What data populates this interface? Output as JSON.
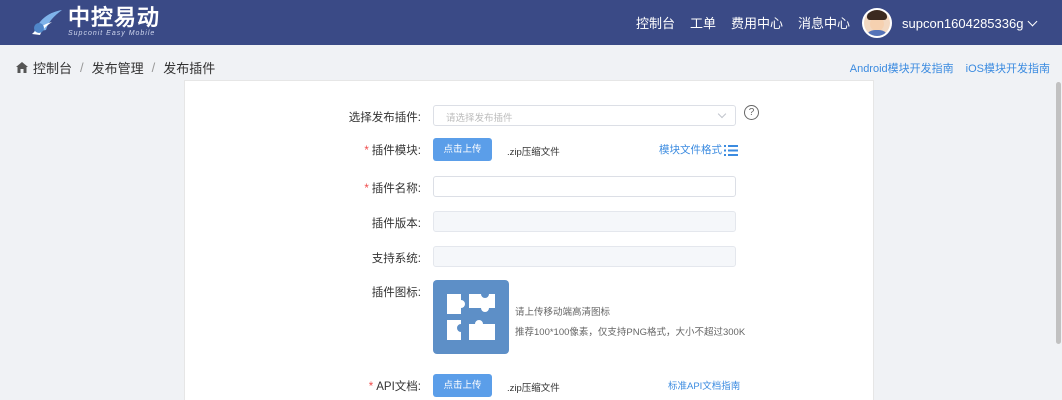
{
  "header": {
    "logo_cn": "中控易动",
    "logo_en": "Supconit Easy Mobile",
    "nav": [
      "控制台",
      "工单",
      "费用中心",
      "消息中心"
    ],
    "username": "supcon1604285336g"
  },
  "breadcrumb": [
    "控制台",
    "发布管理",
    "发布插件"
  ],
  "guides": [
    "Android模块开发指南",
    "iOS模块开发指南"
  ],
  "form": {
    "select_plugin_label": "选择发布插件:",
    "select_plugin_placeholder": "请选择发布插件",
    "help": "?",
    "module_label": "插件模块:",
    "upload_label": "点击上传",
    "zip_hint": ".zip压缩文件",
    "module_format_link": "模块文件格式",
    "name_label": "插件名称:",
    "version_label": "插件版本:",
    "system_label": "支持系统:",
    "icon_label": "插件图标:",
    "icon_hint_1": "请上传移动端高清图标",
    "icon_hint_2": "推荐100*100像素，仅支持PNG格式，大小不超过300K",
    "api_label": "API文档:",
    "api_upload_label": "点击上传",
    "api_zip_hint": ".zip压缩文件",
    "api_guide_link": "标准API文档指南",
    "required_mark": "*"
  },
  "colors": {
    "topbar": "#3a4a86",
    "primary_button": "#5b9ee9",
    "link": "#3b8be0",
    "required": "#f04b4b",
    "icon_bg": "#5d8fc7"
  }
}
